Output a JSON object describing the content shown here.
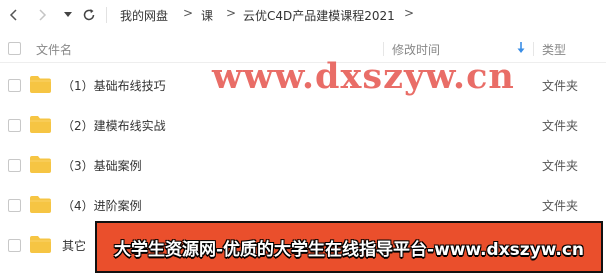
{
  "breadcrumbs": [
    "我的网盘",
    "课",
    "云优C4D产品建模课程2021"
  ],
  "icons": {
    "back": "chevron-left-icon",
    "forward": "chevron-right-icon",
    "history": "caret-down-icon",
    "refresh": "refresh-icon",
    "folder": "folder-icon",
    "sort": "sort-down-arrow-icon",
    "crumb_separator": ">"
  },
  "table_header": {
    "name": "文件名",
    "modified": "修改时间",
    "type": "类型"
  },
  "rows": [
    {
      "name": "（1）基础布线技巧",
      "type": "文件夹"
    },
    {
      "name": "（2）建模布线实战",
      "type": "文件夹"
    },
    {
      "name": "（3）基础案例",
      "type": "文件夹"
    },
    {
      "name": "（4）进阶案例",
      "type": "文件夹"
    },
    {
      "name": "其它",
      "type": ""
    }
  ],
  "watermark": "www.dxszyw.cn",
  "banner": "大学生资源网-优质的大学生在线指导平台-www.dxszyw.cn",
  "colors": {
    "folder": "#f6c543",
    "sort_arrow": "#3a8ee6",
    "watermark": "#e8665f",
    "banner_bg": "#ea4f2c"
  }
}
